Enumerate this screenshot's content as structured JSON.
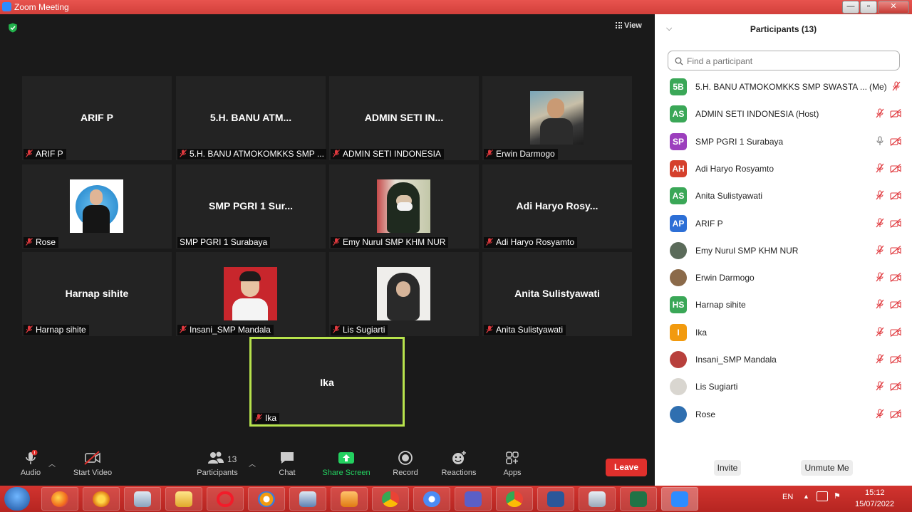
{
  "window": {
    "title": "Zoom Meeting",
    "controls": [
      "—",
      "▫",
      "✕"
    ]
  },
  "stage": {
    "view_label": "View",
    "tiles": [
      {
        "big": "ARIF P",
        "label": "ARIF P"
      },
      {
        "big": "5.H. BANU ATM...",
        "label": "5.H. BANU ATMOKOMKKS SMP ..."
      },
      {
        "big": "ADMIN SETI IN...",
        "label": "ADMIN SETI INDONESIA"
      },
      {
        "big": "",
        "label": "Erwin Darmogo"
      },
      {
        "big": "",
        "label": "Rose"
      },
      {
        "big": "SMP PGRI 1 Sur...",
        "label": "SMP PGRI 1 Surabaya"
      },
      {
        "big": "",
        "label": "Emy Nurul SMP  KHM NUR"
      },
      {
        "big": "Adi Haryo Rosy...",
        "label": "Adi Haryo Rosyamto"
      },
      {
        "big": "Harnap sihite",
        "label": "Harnap sihite"
      },
      {
        "big": "",
        "label": "Insani_SMP Mandala"
      },
      {
        "big": "",
        "label": "Lis Sugiarti"
      },
      {
        "big": "Anita Sulistyawati",
        "label": "Anita Sulistyawati"
      },
      {
        "big": "Ika",
        "label": "Ika"
      }
    ]
  },
  "toolbar": {
    "audio": "Audio",
    "audio_badge": "!",
    "start_video": "Start Video",
    "participants": "Participants",
    "participants_count": "13",
    "chat": "Chat",
    "share_screen": "Share Screen",
    "record": "Record",
    "reactions": "Reactions",
    "apps": "Apps",
    "leave": "Leave"
  },
  "panel": {
    "title": "Participants (13)",
    "search_placeholder": "Find a participant",
    "me_label": "(Me)",
    "participants": [
      {
        "initials": "5B",
        "name": "5.H. BANU ATMOKOMKKS SMP SWASTA ...",
        "color": "#3aa757"
      },
      {
        "initials": "AS",
        "name": "ADMIN SETI INDONESIA (Host)",
        "color": "#3aa757"
      },
      {
        "initials": "SP",
        "name": "SMP PGRI 1 Surabaya",
        "color": "#9c3fbd"
      },
      {
        "initials": "AH",
        "name": "Adi Haryo Rosyamto",
        "color": "#d5402c"
      },
      {
        "initials": "AS",
        "name": "Anita Sulistyawati",
        "color": "#3aa757"
      },
      {
        "initials": "AP",
        "name": "ARIF P",
        "color": "#2d6fd6"
      },
      {
        "initials": "",
        "name": "Emy Nurul SMP  KHM NUR",
        "color": "#5b6b5a"
      },
      {
        "initials": "",
        "name": "Erwin Darmogo",
        "color": "#8b6a4a"
      },
      {
        "initials": "HS",
        "name": "Harnap sihite",
        "color": "#3aa757"
      },
      {
        "initials": "I",
        "name": "Ika",
        "color": "#f29a0e"
      },
      {
        "initials": "",
        "name": "Insani_SMP Mandala",
        "color": "#b8403c"
      },
      {
        "initials": "",
        "name": "Lis Sugiarti",
        "color": "#d9d6d0"
      },
      {
        "initials": "",
        "name": "Rose",
        "color": "#2f6fb0"
      }
    ],
    "invite": "Invite",
    "unmute_me": "Unmute Me"
  },
  "taskbar": {
    "language": "EN",
    "time": "15:12",
    "date": "15/07/2022"
  }
}
